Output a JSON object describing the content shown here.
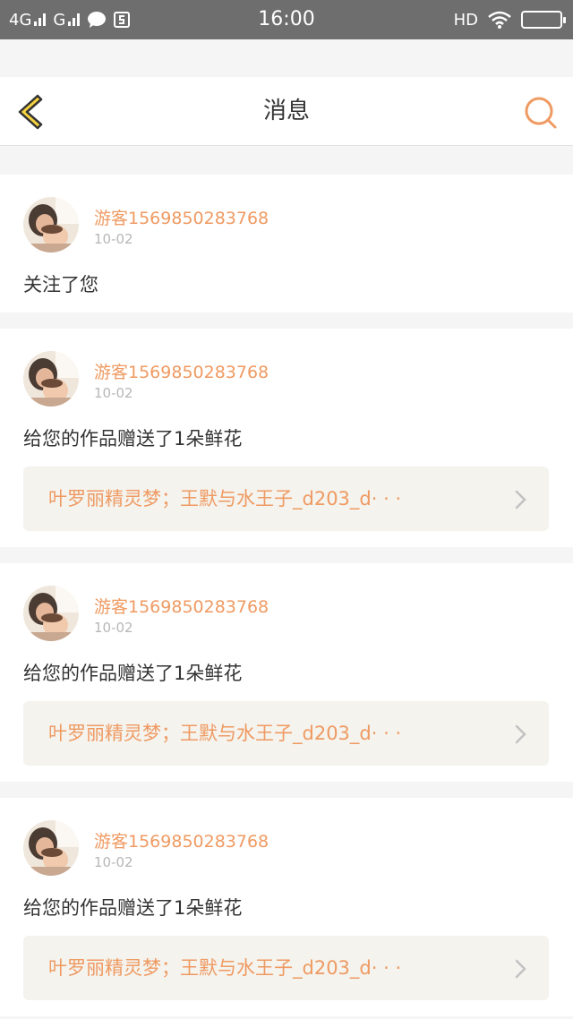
{
  "status_bar": {
    "network1": "4G",
    "network2": "G",
    "time": "16:00",
    "hd": "HD"
  },
  "header": {
    "title": "消息",
    "back_icon": "chevron-left-icon",
    "search_icon": "search-icon"
  },
  "colors": {
    "accent": "#ef9a62",
    "back_icon_fill": "#f6d23f",
    "link_bg": "#f4f3ee"
  },
  "notifications": [
    {
      "username": "游客1569850283768",
      "date": "10-02",
      "message": "关注了您"
    },
    {
      "username": "游客1569850283768",
      "date": "10-02",
      "message": "给您的作品赠送了1朵鲜花",
      "work_title": "叶罗丽精灵梦；王默与水王子_d203_d· · ·"
    },
    {
      "username": "游客1569850283768",
      "date": "10-02",
      "message": "给您的作品赠送了1朵鲜花",
      "work_title": "叶罗丽精灵梦；王默与水王子_d203_d· · ·"
    },
    {
      "username": "游客1569850283768",
      "date": "10-02",
      "message": "给您的作品赠送了1朵鲜花",
      "work_title": "叶罗丽精灵梦；王默与水王子_d203_d· · ·"
    }
  ]
}
